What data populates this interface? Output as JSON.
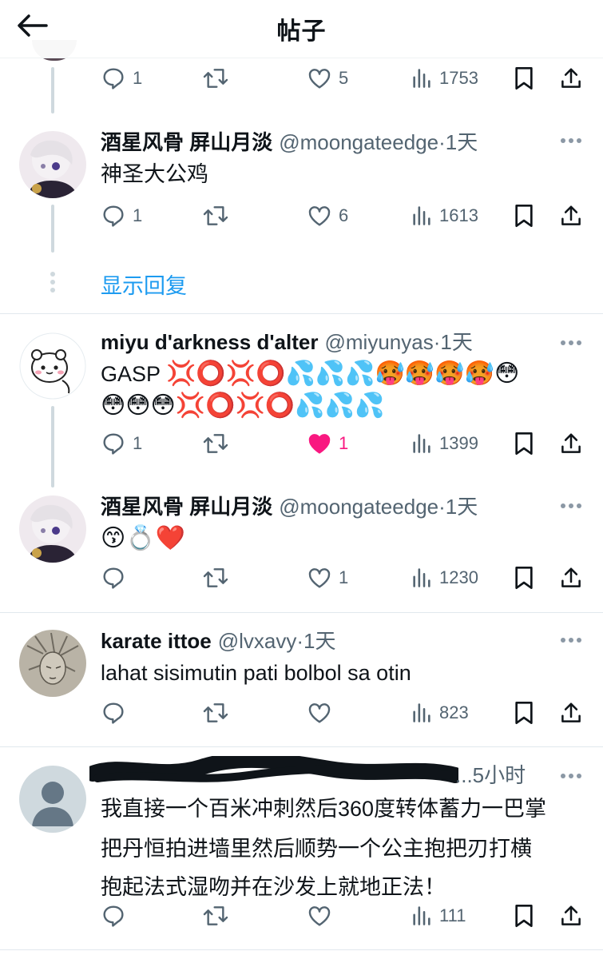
{
  "header": {
    "title": "帖子"
  },
  "show_replies_label": "显示回复",
  "colors": {
    "accent": "#1d9bf0",
    "like": "#f91880",
    "muted": "#536471",
    "text": "#0f1419"
  },
  "top_actions": {
    "replies": "1",
    "reposts": "",
    "likes": "5",
    "views": "1753"
  },
  "posts": [
    {
      "name": "酒星风骨 屏山月淡",
      "handle": "@moongateedge",
      "time": "·1天",
      "text": "神圣大公鸡",
      "avatar": "anime-doll-avatar",
      "actions": {
        "replies": "1",
        "reposts": "",
        "likes": "6",
        "views": "1613",
        "liked": false
      }
    },
    {
      "name": "miyu d'arkness d'alter",
      "handle": "@miyunyas",
      "time": "·1天",
      "text_prefix": "GASP",
      "emoji_line1": "💢⭕💢⭕💦💦💦🥵🥵🥵🥵😳",
      "emoji_line2": "😳😳😳💢⭕💢⭕💦💦💦",
      "avatar": "white-bear-avatar",
      "actions": {
        "replies": "1",
        "reposts": "",
        "likes": "1",
        "views": "1399",
        "liked": true
      }
    },
    {
      "name": "酒星风骨 屏山月淡",
      "handle": "@moongateedge",
      "time": "·1天",
      "emoji_line1": "😙💍❤️",
      "avatar": "anime-doll-avatar",
      "actions": {
        "replies": "",
        "reposts": "",
        "likes": "1",
        "views": "1230",
        "liked": false
      }
    },
    {
      "name": "karate ittoe",
      "handle": "@lvxavy",
      "time": "·1天",
      "text": "lahat sisimutin pati bolbol sa otin",
      "avatar": "sketch-avatar",
      "actions": {
        "replies": "",
        "reposts": "",
        "likes": "",
        "views": "823",
        "liked": false
      }
    },
    {
      "time": "...5小时",
      "lines": [
        "我直接一个百米冲刺然后360度转体蓄力一巴掌",
        "把丹恒拍进墙里然后顺势一个公主抱把刃打横",
        "抱起法式湿吻并在沙发上就地正法！"
      ],
      "avatar": "default-avatar",
      "actions": {
        "replies": "",
        "reposts": "",
        "likes": "",
        "views": "111",
        "liked": false
      }
    }
  ]
}
